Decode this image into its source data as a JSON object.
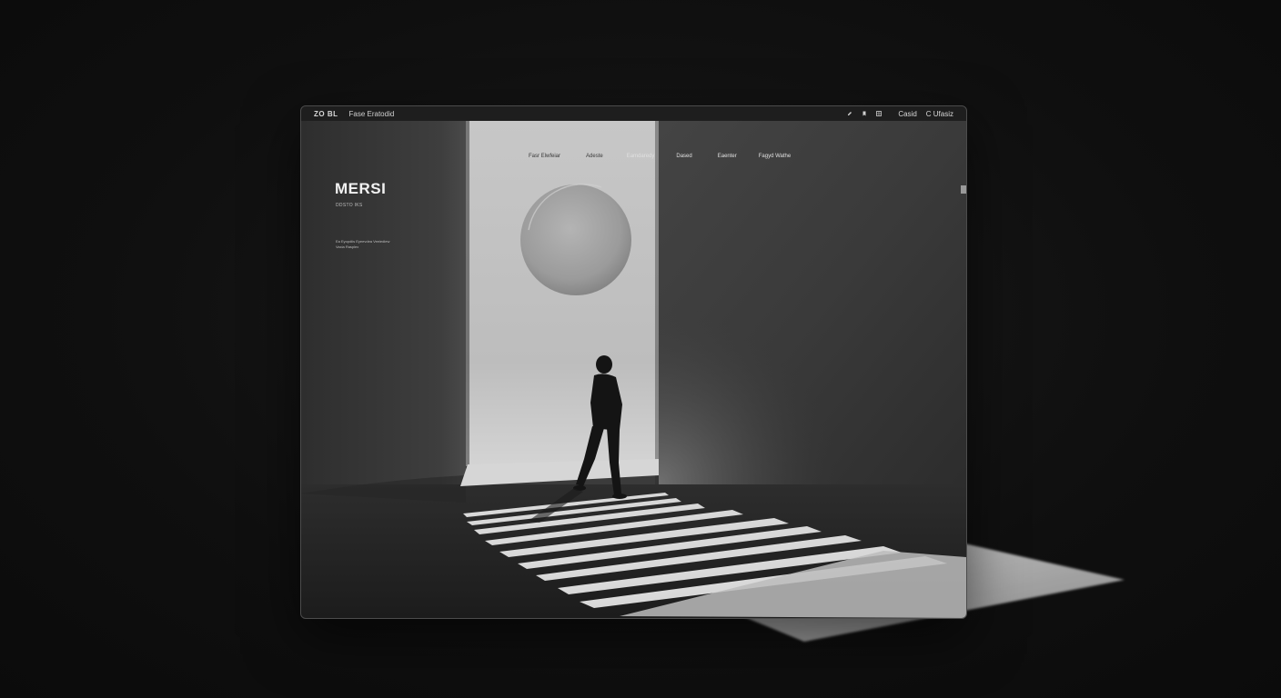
{
  "titlebar": {
    "brand": "ZO BL",
    "document_title": "Fase Eratodid",
    "right_items": [
      "Casid",
      "C Ufasiz"
    ]
  },
  "hero": {
    "title": "MERSI",
    "subtitle": "DDSTO IKS",
    "description": "Ea Eyopdiis Eyeevdea Veeiediew Vaxia Rasplex"
  },
  "nav": {
    "items": [
      "Fasr Elwfeiar",
      "Adeste",
      "Eamdaredy",
      "Dased",
      "Eaenter",
      "Fagyd Wathe"
    ]
  },
  "icons": {
    "titlebar": [
      "edit-icon",
      "bookmark-icon",
      "grid-icon"
    ]
  },
  "colors": {
    "background": "#0e0e0e",
    "window_frame": "#1e1e1e",
    "light_panel": "#bdbdbd",
    "shadow_wall": "#3a3a3a",
    "light_beam": "#e6e6e6"
  }
}
